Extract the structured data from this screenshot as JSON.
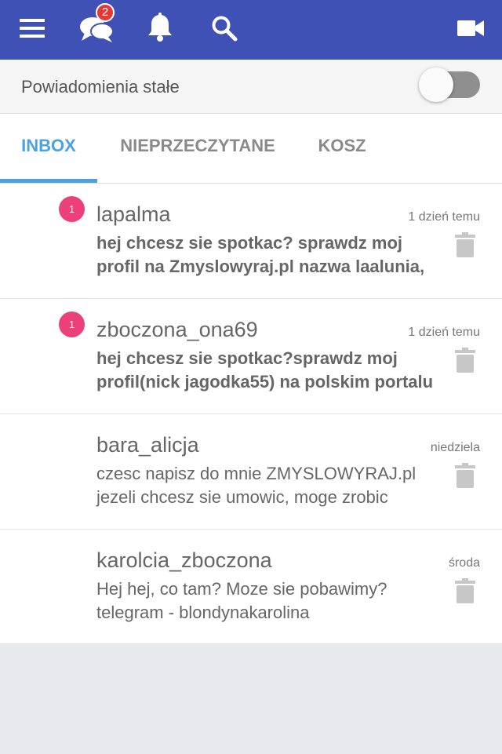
{
  "colors": {
    "topbar": "#3f51b5",
    "accent": "#4aa3df",
    "unread": "#ec407a",
    "badge": "#e53935"
  },
  "topbar": {
    "icons": [
      "menu-icon",
      "chat-icon",
      "bell-icon",
      "search-icon",
      "video-camera-icon"
    ],
    "chat_badge": "2"
  },
  "settings": {
    "label": "Powiadomienia stałe",
    "toggle_on": false
  },
  "tabs": [
    {
      "label": "INBOX",
      "active": true
    },
    {
      "label": "NIEPRZECZYTANE",
      "active": false
    },
    {
      "label": "KOSZ",
      "active": false
    }
  ],
  "messages": [
    {
      "sender": "lapalma",
      "time": "1 dzień temu",
      "unread": "1",
      "preview1": "hej chcesz sie spotkac? sprawdz moj",
      "preview2": "profil na Zmyslowyraj.pl nazwa laalunia,"
    },
    {
      "sender": "zboczona_ona69",
      "time": "1 dzień temu",
      "unread": "1",
      "preview1": "hej chcesz sie spotkac?sprawdz moj",
      "preview2": "profil(nick jagodka55) na polskim portalu"
    },
    {
      "sender": "bara_alicja",
      "time": "niedziela",
      "unread": "",
      "preview1": "czesc napisz do mnie ZMYSLOWYRAJ.pl",
      "preview2": "jezeli chcesz sie umowic, moge zrobic"
    },
    {
      "sender": "karolcia_zboczona",
      "time": "środa",
      "unread": "",
      "preview1": "Hej hej, co tam? Moze sie pobawimy?",
      "preview2": "telegram - blondynakarolina"
    }
  ]
}
